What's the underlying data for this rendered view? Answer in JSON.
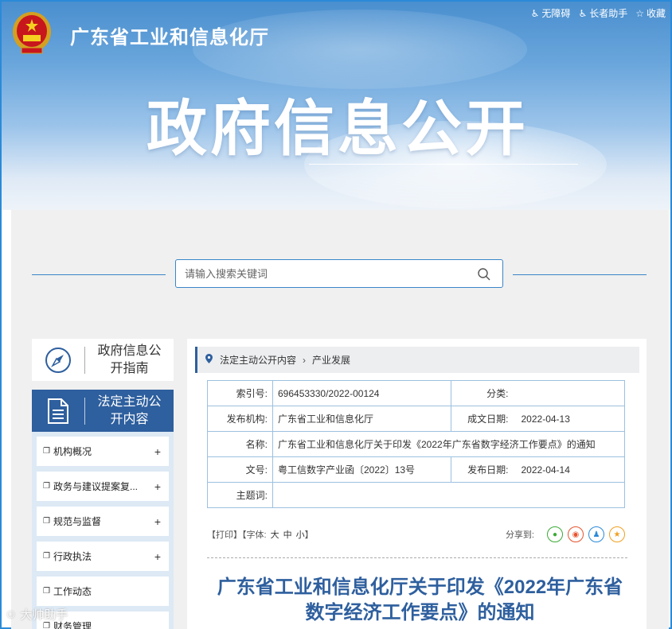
{
  "header": {
    "site_name": "广东省工业和信息化厅",
    "banner_title": "政府信息公开",
    "links": [
      {
        "label": "无障碍",
        "icon": "accessibility-icon"
      },
      {
        "label": "长者助手",
        "icon": "elder-helper-icon"
      },
      {
        "label": "收藏",
        "icon": "star-icon"
      }
    ]
  },
  "search": {
    "placeholder": "请输入搜索关键词"
  },
  "sidebar": {
    "guide_label": "政府信息公开指南",
    "active_label": "法定主动公开内容",
    "items": [
      {
        "label": "机构概况"
      },
      {
        "label": "政务与建议提案复..."
      },
      {
        "label": "规范与监督"
      },
      {
        "label": "行政执法"
      },
      {
        "label": "工作动态"
      },
      {
        "label": "财务管理"
      }
    ]
  },
  "breadcrumb": {
    "level1": "法定主动公开内容",
    "level2": "产业发展"
  },
  "meta": {
    "index_label": "索引号:",
    "index_value": "696453330/2022-00124",
    "category_label": "分类:",
    "category_value": "",
    "publisher_label": "发布机构:",
    "publisher_value": "广东省工业和信息化厅",
    "created_label": "成文日期:",
    "created_value": "2022-04-13",
    "name_label": "名称:",
    "name_value": "广东省工业和信息化厅关于印发《2022年广东省数字经济工作要点》的通知",
    "docno_label": "文号:",
    "docno_value": "粤工信数字产业函〔2022〕13号",
    "pubdate_label": "发布日期:",
    "pubdate_value": "2022-04-14",
    "subject_label": "主题词:",
    "subject_value": ""
  },
  "tools": {
    "print": "【打印】",
    "font_label": "【字体:",
    "font_large": "大",
    "font_medium": "中",
    "font_small": "小",
    "font_close": "】",
    "share_label": "分享到:"
  },
  "article": {
    "title_line1": "广东省工业和信息化厅关于印发《2022年广东省",
    "title_line2": "数字经济工作要点》的通知"
  },
  "watermark": "大帅助手",
  "colors": {
    "primary": "#2e5f9e",
    "accent": "#3a86c8",
    "share_wechat": "#3aaa35",
    "share_weibo": "#e6532d",
    "share_qq": "#2a8ad8",
    "share_qzone": "#f0a020"
  }
}
